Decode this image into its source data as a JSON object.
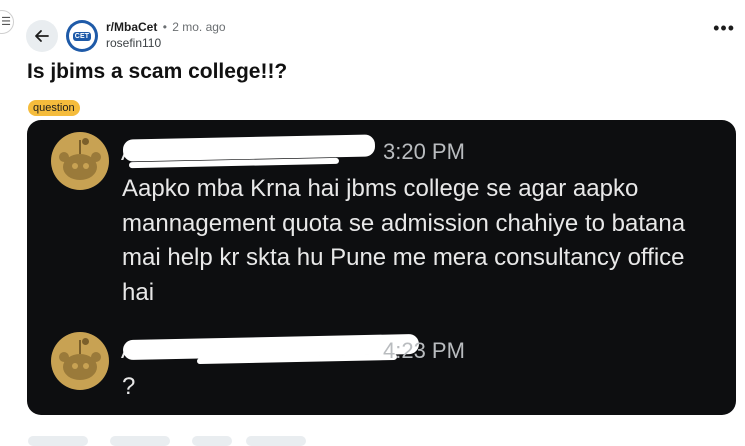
{
  "post": {
    "subreddit": "r/MbaCet",
    "separator": "•",
    "age": "2 mo. ago",
    "author": "rosefin110",
    "title": "Is jbims a scam college!!?",
    "flair": "question",
    "subreddit_icon_text": "CET"
  },
  "icons": {
    "menu": "hamburger-icon",
    "back": "arrow-left-icon",
    "more": "more-horizontal-icon",
    "avatar": "reddit-snoo-avatar-icon"
  },
  "chat": {
    "messages": [
      {
        "sender_visible": "A",
        "time": "3:20 PM",
        "text": "Aapko mba Krna hai jbms college se agar aapko mannagement quota se admission chahiye to batana mai help kr skta hu Pune me mera consultancy office hai"
      },
      {
        "sender_visible": "A",
        "time": "4:23 PM",
        "text": "?"
      }
    ]
  },
  "colors": {
    "flair_bg": "#f5bc3c",
    "image_bg": "#0d0e10",
    "subreddit_blue": "#1e5aa8"
  }
}
